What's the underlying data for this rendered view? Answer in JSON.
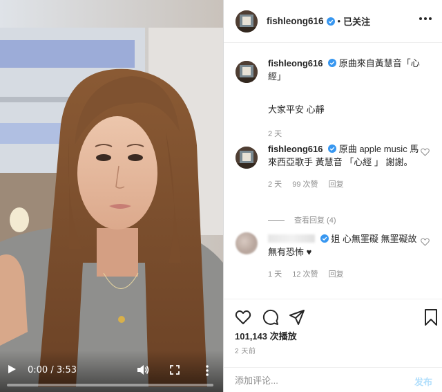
{
  "video": {
    "time_current": "0:00",
    "time_separator": "/",
    "time_total": "3:53",
    "progress": 0.0
  },
  "header": {
    "username": "fishleong616",
    "separator": "•",
    "follow_status": "已关注"
  },
  "caption": {
    "username": "fishleong616",
    "text": "原曲來自黃慧音「心經」",
    "body": "大家平安 心靜",
    "time": "2 天"
  },
  "comments": [
    {
      "username": "fishleong616",
      "text": "原曲 apple music 馬來西亞歌手 黃慧音 「心經 」 謝謝。",
      "time": "2 天",
      "likes": "99 次赞",
      "reply_label": "回复",
      "view_replies": "查看回复 (4)"
    },
    {
      "text": "姐 心無罣礙 無罣礙故無有恐怖 ♥",
      "time": "1 天",
      "likes": "12 次赞",
      "reply_label": "回复"
    }
  ],
  "stats": {
    "views": "101,143 次播放",
    "time_ago": "2 天前"
  },
  "add_comment": {
    "placeholder": "添加评论...",
    "post_label": "发布"
  },
  "colors": {
    "verified": "#3897f0",
    "post_button": "#b2dffc",
    "meta_text": "#8e8e8e"
  }
}
